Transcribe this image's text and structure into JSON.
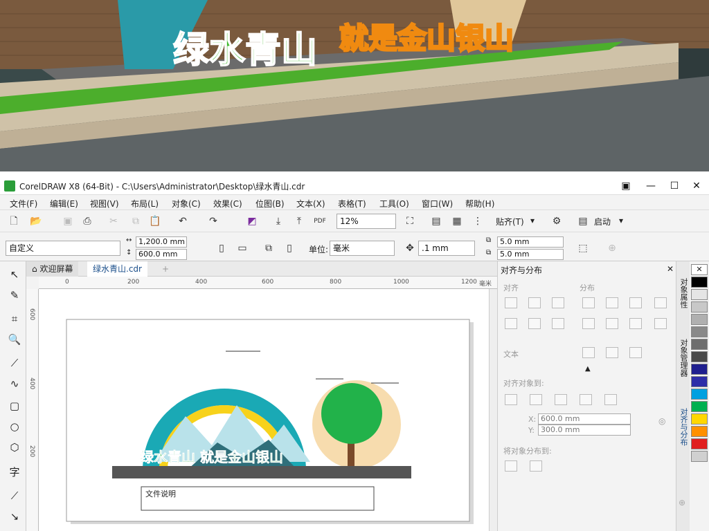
{
  "photo": {
    "sign_text_green": "绿水青山",
    "sign_text_orange": "就是金山银山"
  },
  "window": {
    "title": "CorelDRAW X8 (64-Bit) - C:\\Users\\Administrator\\Desktop\\绿水青山.cdr",
    "minimize": "—",
    "maximize": "☐",
    "close": "✕"
  },
  "menu": [
    "文件(F)",
    "编辑(E)",
    "视图(V)",
    "布局(L)",
    "对象(C)",
    "效果(C)",
    "位图(B)",
    "文本(X)",
    "表格(T)",
    "工具(O)",
    "窗口(W)",
    "帮助(H)"
  ],
  "toolbar": {
    "zoom": "12%",
    "snap_label": "贴齐(T)",
    "launch_label": "启动"
  },
  "propbar": {
    "preset": "自定义",
    "width": "1,200.0 mm",
    "height": "600.0 mm",
    "unit_label": "单位:",
    "unit_value": "毫米",
    "nudge": ".1 mm",
    "dup_x": "5.0 mm",
    "dup_y": "5.0 mm"
  },
  "doc_tabs": {
    "welcome": "欢迎屏幕",
    "file": "绿水青山.cdr"
  },
  "ruler": {
    "h_labels": [
      "0",
      "200",
      "400",
      "600",
      "800",
      "1000",
      "1200"
    ],
    "h_unit": "毫米",
    "v_labels": [
      "600",
      "400",
      "200"
    ]
  },
  "artwork": {
    "slogan": "绿水青山 就是金山银山",
    "doc_label": "文件说明"
  },
  "panel": {
    "title": "对齐与分布",
    "align": "对齐",
    "distribute": "分布",
    "text": "文本",
    "align_to": "对齐对象到:",
    "x_label": "X:",
    "x_value": "600.0 mm",
    "y_label": "Y:",
    "y_value": "300.0 mm",
    "distribute_to": "将对象分布到:"
  },
  "side_tabs": [
    "对象属性",
    "对象管理器",
    "对齐与分布"
  ],
  "palette_colors": [
    "#ffffff",
    "#000000",
    "#e5e5e5",
    "#c8c8c8",
    "#b0b0b0",
    "#8a8a8a",
    "#6e6e6e",
    "#4a4a4a",
    "#1f1f8f",
    "#2e2ea8",
    "#00a0e0",
    "#00b050",
    "#ffd700",
    "#ff9000",
    "#e02020",
    "#d0d0d0"
  ]
}
